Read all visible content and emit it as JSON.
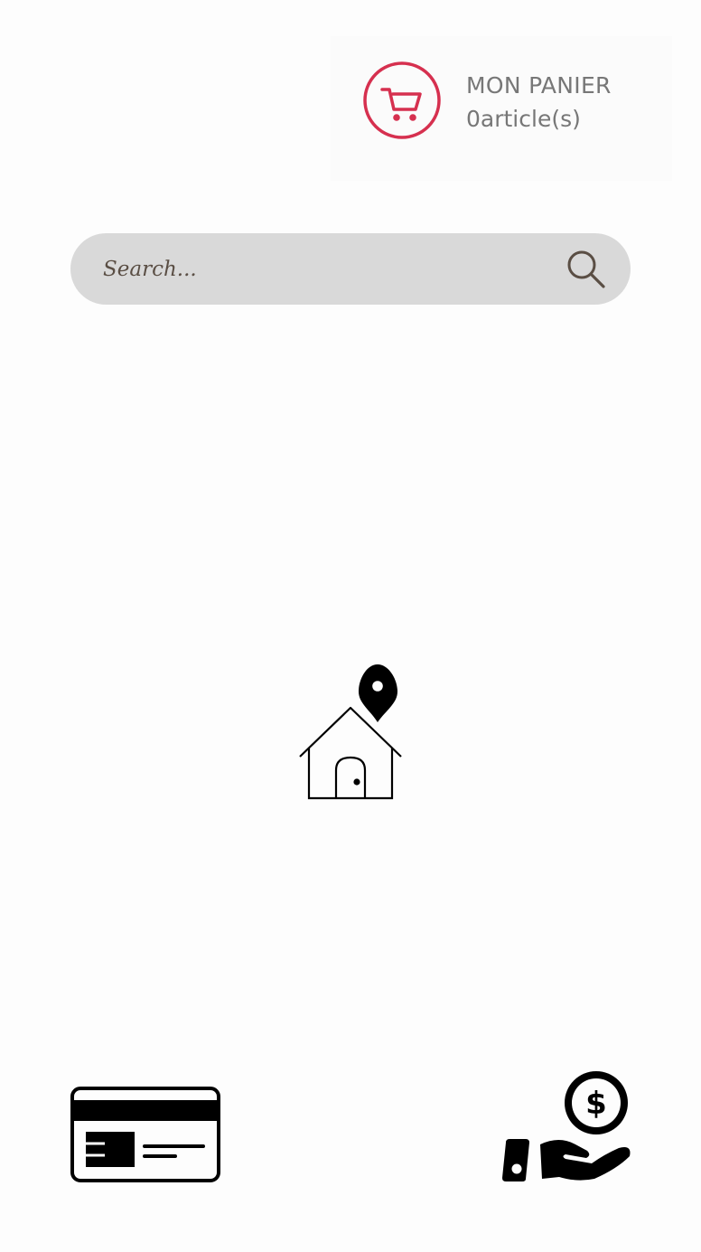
{
  "cart": {
    "title": "MON PANIER",
    "count": "0article(s)"
  },
  "search": {
    "placeholder": "Search..."
  },
  "icons": {
    "cart": "shopping-cart-icon",
    "search": "magnifier-icon",
    "home": "house-location-pin-icon",
    "card": "credit-card-icon",
    "cash": "hand-coin-dollar-icon"
  },
  "colors": {
    "cart_accent": "#d6304f",
    "cart_text": "#777777",
    "search_background": "#d9d9d9",
    "search_text": "#5a4e44",
    "icon_stroke": "#000000"
  }
}
